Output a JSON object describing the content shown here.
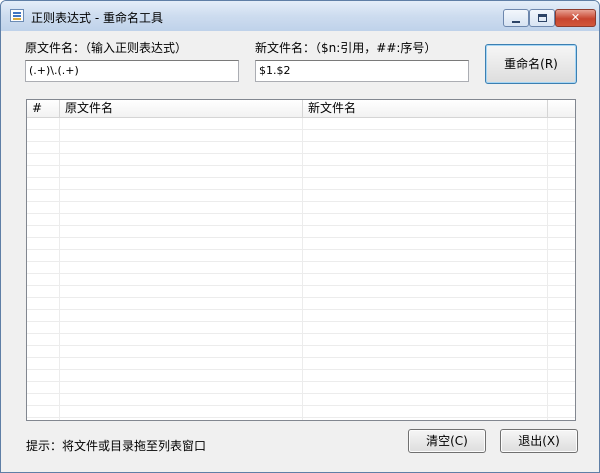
{
  "window": {
    "title": "正则表达式 - 重命名工具",
    "app_icon": "app-icon",
    "controls": {
      "minimize_icon": "minimize-icon",
      "maximize_icon": "maximize-icon",
      "close_icon": "close-icon",
      "close_glyph": "✕"
    }
  },
  "form": {
    "source_label": "原文件名：（输入正则表达式）",
    "source_value": "(.+)\\.(.+)",
    "target_label": "新文件名：（$n:引用，##:序号）",
    "target_value": "$1.$2",
    "rename_button": "重命名(R)"
  },
  "list": {
    "columns": [
      "#",
      "原文件名",
      "新文件名"
    ],
    "rows": []
  },
  "footer": {
    "hint": "提示：将文件或目录拖至列表窗口",
    "clear_button": "清空(C)",
    "exit_button": "退出(X)"
  },
  "colors": {
    "titlebar": "#cddcef",
    "close_button": "#c7452f",
    "window_bg": "#f0f0f0"
  }
}
